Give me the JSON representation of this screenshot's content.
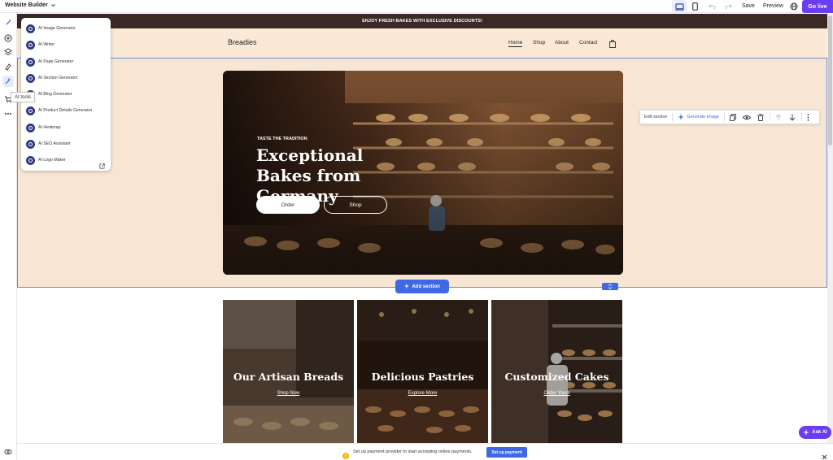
{
  "topbar": {
    "site_name": "Website Builder",
    "save_label": "Save",
    "preview_label": "Preview",
    "go_live_label": "Go live"
  },
  "rail": {
    "tooltip": "AI tools"
  },
  "ai_menu": {
    "items": [
      "AI Image Generator",
      "AI Writer",
      "AI Page Generator",
      "AI Section Generator",
      "AI Blog Generator",
      "AI Product Details Generator",
      "AI Heatmap",
      "AI SEO Assistant",
      "AI Logo Maker"
    ]
  },
  "site": {
    "banner": "ENJOY FRESH BAKES WITH EXCLUSIVE DISCOUNTS!",
    "logo": "Breadies",
    "nav": [
      "Home",
      "Shop",
      "About",
      "Contact"
    ]
  },
  "hero": {
    "tagline": "TASTE THE TRADITION",
    "title": "Exceptional Bakes from Germany",
    "order_label": "Order",
    "shop_label": "Shop"
  },
  "section_toolbar": {
    "edit_label": "Edit section",
    "generate_label": "Generate image"
  },
  "add_section_label": "Add section",
  "cards": [
    {
      "title": "Our Artisan Breads",
      "link": "Shop Now"
    },
    {
      "title": "Delicious Pastries",
      "link": "Explore More"
    },
    {
      "title": "Customized Cakes",
      "link": "Order Yours"
    }
  ],
  "notice": {
    "text": "Set up payment provider to start accepting online payments.",
    "button": "Set up payment"
  },
  "ask_ai_label": "Ask AI",
  "colors": {
    "accent": "#3f68e6",
    "brand_purple": "#6a3cf2",
    "header_bg": "#fbe9d7",
    "banner_bg": "#3a2a26"
  }
}
